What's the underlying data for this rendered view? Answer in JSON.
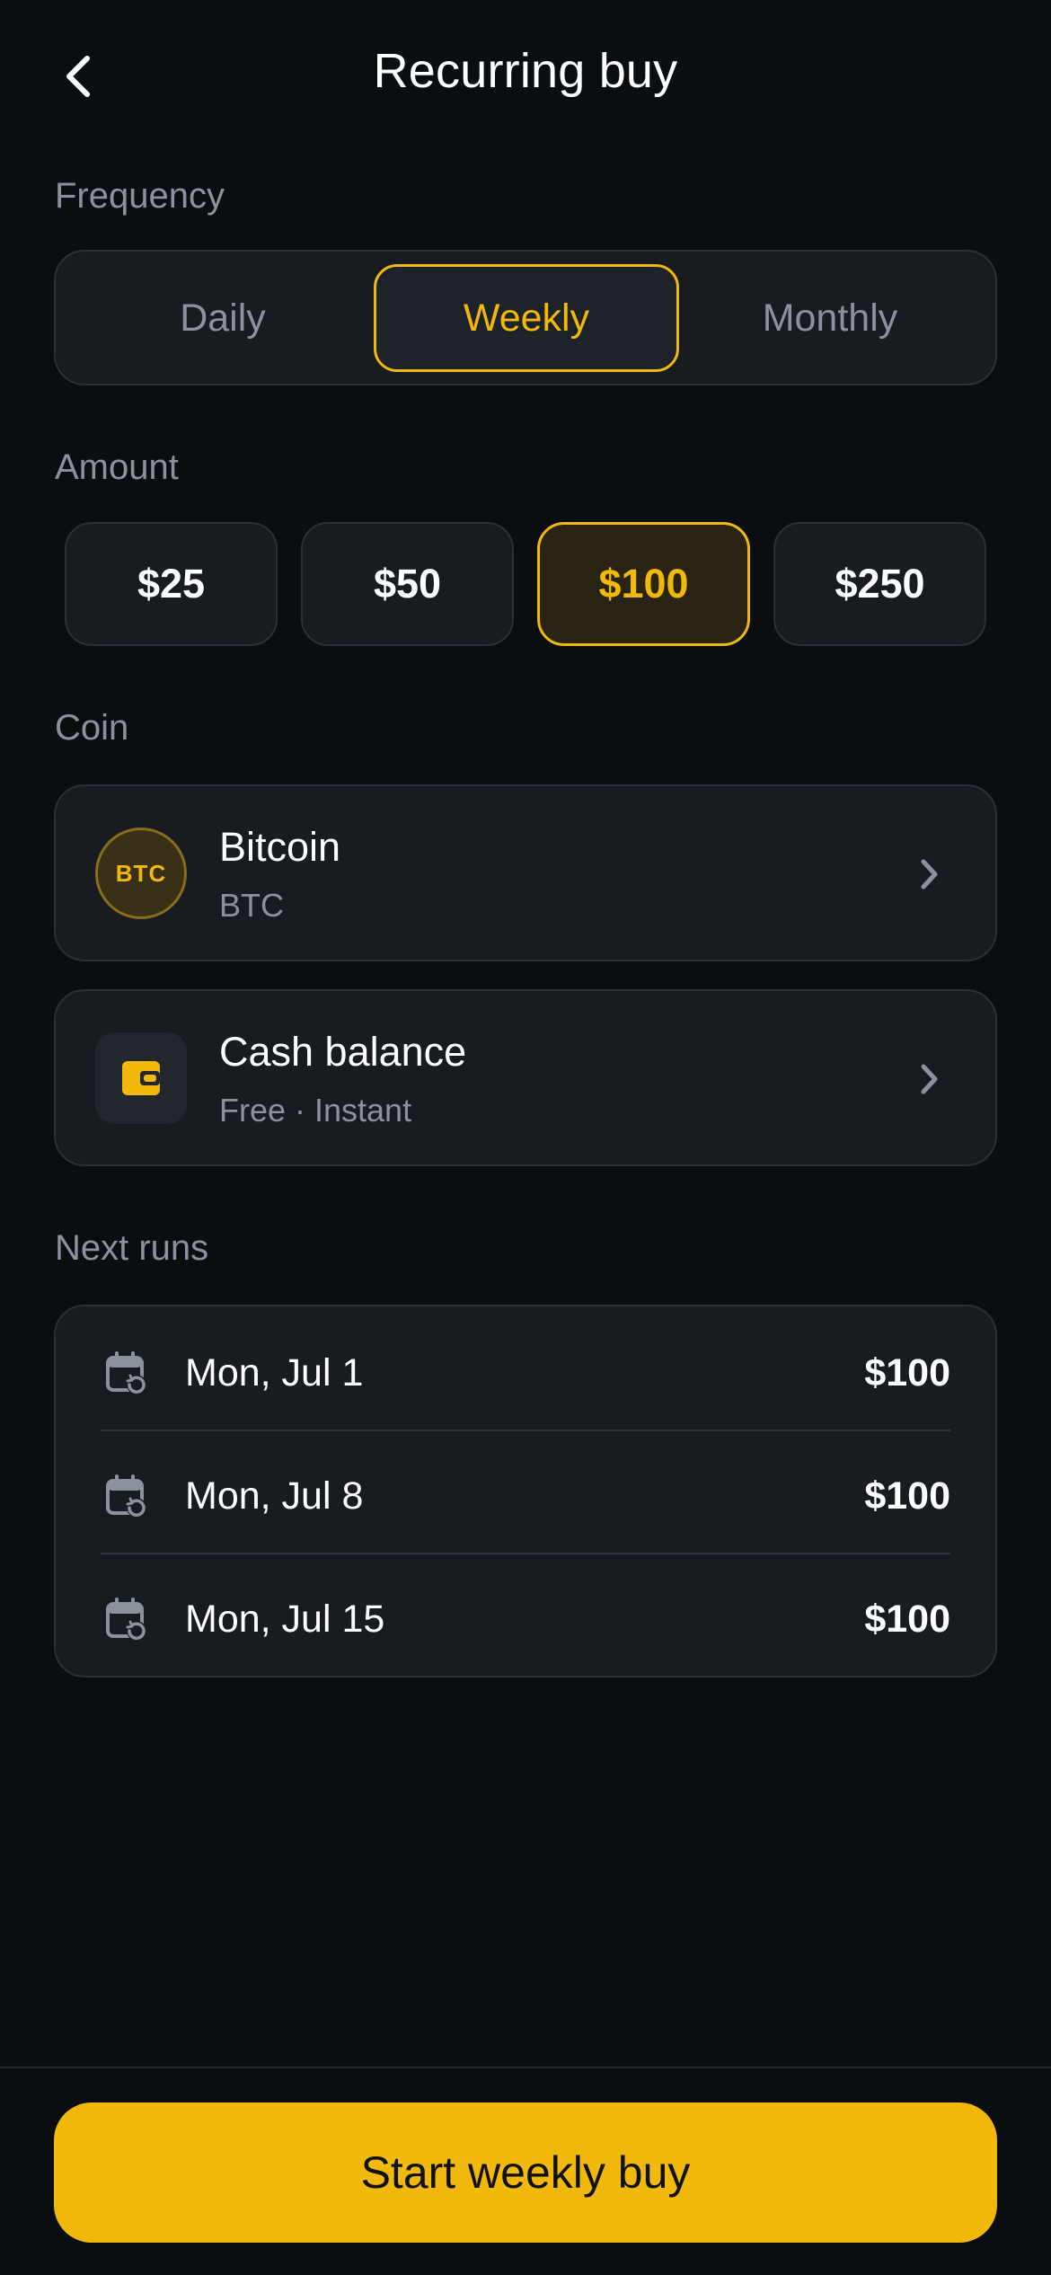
{
  "header": {
    "title": "Recurring buy"
  },
  "frequency": {
    "label": "Frequency",
    "options": [
      "Daily",
      "Weekly",
      "Monthly"
    ],
    "selected": "Weekly"
  },
  "amount": {
    "label": "Amount",
    "options": [
      "$25",
      "$50",
      "$100",
      "$250"
    ],
    "selected": "$100"
  },
  "coin": {
    "label": "Coin",
    "name": "Bitcoin",
    "ticker": "BTC",
    "badge_text": "BTC"
  },
  "payment": {
    "title": "Cash balance",
    "subtitle": "Free · Instant"
  },
  "next_runs": {
    "label": "Next runs",
    "rows": [
      {
        "date": "Mon, Jul 1",
        "amount": "$100"
      },
      {
        "date": "Mon, Jul 8",
        "amount": "$100"
      },
      {
        "date": "Mon, Jul 15",
        "amount": "$100"
      }
    ]
  },
  "cta": {
    "label": "Start weekly buy"
  },
  "colors": {
    "accent": "#f0b90b",
    "background": "#0b0e11",
    "card": "#181b20",
    "muted": "#8b929e"
  },
  "icons": {
    "back": "chevron-left-icon",
    "chevron": "chevron-right-icon",
    "wallet": "wallet-icon",
    "calendar": "calendar-repeat-icon"
  }
}
